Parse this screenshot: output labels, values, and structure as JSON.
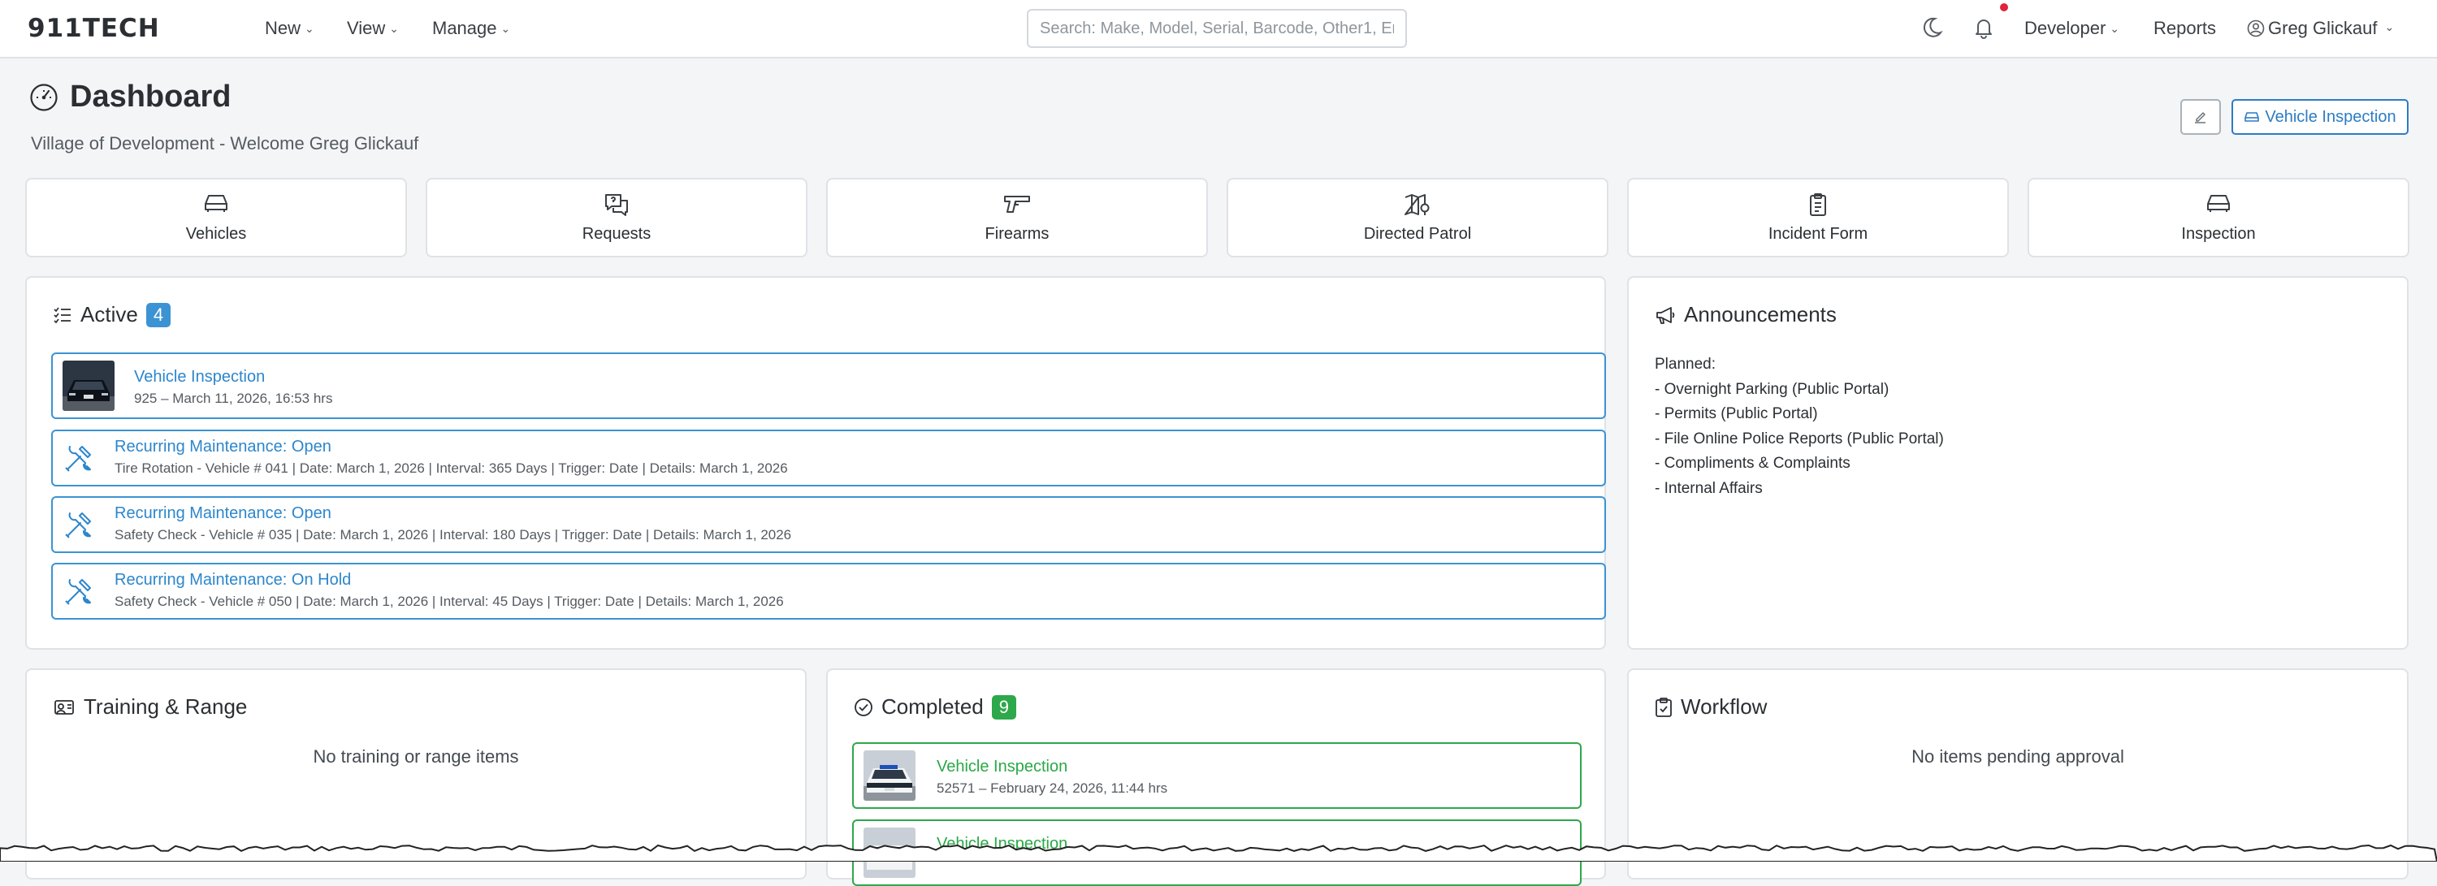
{
  "nav": {
    "logo": "911TECH",
    "menu": [
      {
        "label": "New"
      },
      {
        "label": "View"
      },
      {
        "label": "Manage"
      }
    ],
    "search_placeholder": "Search: Make, Model, Serial, Barcode, Other1, Em",
    "developer_label": "Developer",
    "reports_label": "Reports",
    "user_label": "Greg Glickauf",
    "has_notification": true
  },
  "header": {
    "title": "Dashboard",
    "subtitle": "Village of Development - Welcome Greg Glickauf",
    "vehicle_inspection_button": "Vehicle Inspection"
  },
  "tiles": [
    {
      "label": "Vehicles",
      "icon": "car-icon"
    },
    {
      "label": "Requests",
      "icon": "chat-question-icon"
    },
    {
      "label": "Firearms",
      "icon": "pistol-icon"
    },
    {
      "label": "Directed Patrol",
      "icon": "map-pin-icon"
    },
    {
      "label": "Incident Form",
      "icon": "clipboard-icon"
    },
    {
      "label": "Inspection",
      "icon": "car-icon"
    }
  ],
  "active": {
    "title": "Active",
    "count": "4",
    "items": [
      {
        "title": "Vehicle Inspection",
        "detail": "925 – March 11, 2026, 16:53 hrs",
        "icon": "vehicle-thumbnail"
      },
      {
        "title": "Recurring Maintenance: Open",
        "detail": "Tire Rotation - Vehicle # 041 | Date: March 1, 2026 | Interval: 365 Days | Trigger: Date | Details: March 1, 2026",
        "icon": "wrench-screwdriver-icon"
      },
      {
        "title": "Recurring Maintenance: Open",
        "detail": "Safety Check - Vehicle # 035 | Date: March 1, 2026 | Interval: 180 Days | Trigger: Date | Details: March 1, 2026",
        "icon": "wrench-screwdriver-icon"
      },
      {
        "title": "Recurring Maintenance: On Hold",
        "detail": "Safety Check - Vehicle # 050 | Date: March 1, 2026 | Interval: 45 Days | Trigger: Date | Details: March 1, 2026",
        "icon": "wrench-screwdriver-icon"
      }
    ]
  },
  "announcements": {
    "title": "Announcements",
    "lines": [
      "Planned:",
      "- Overnight Parking (Public Portal)",
      "- Permits (Public Portal)",
      "- File Online Police Reports (Public Portal)",
      "- Compliments & Complaints",
      "- Internal Affairs"
    ]
  },
  "training": {
    "title": "Training & Range",
    "empty": "No training or range items"
  },
  "completed": {
    "title": "Completed",
    "count": "9",
    "items": [
      {
        "title": "Vehicle Inspection",
        "detail": "52571 – February 24, 2026, 11:44 hrs"
      },
      {
        "title": "Vehicle Inspection",
        "detail": ""
      }
    ]
  },
  "workflow": {
    "title": "Workflow",
    "empty": "No items pending approval"
  },
  "colors": {
    "accent_blue": "#2c86cc",
    "badge_blue": "#3b93d4",
    "success_green": "#2aa846",
    "notification_red": "#e0243c"
  }
}
